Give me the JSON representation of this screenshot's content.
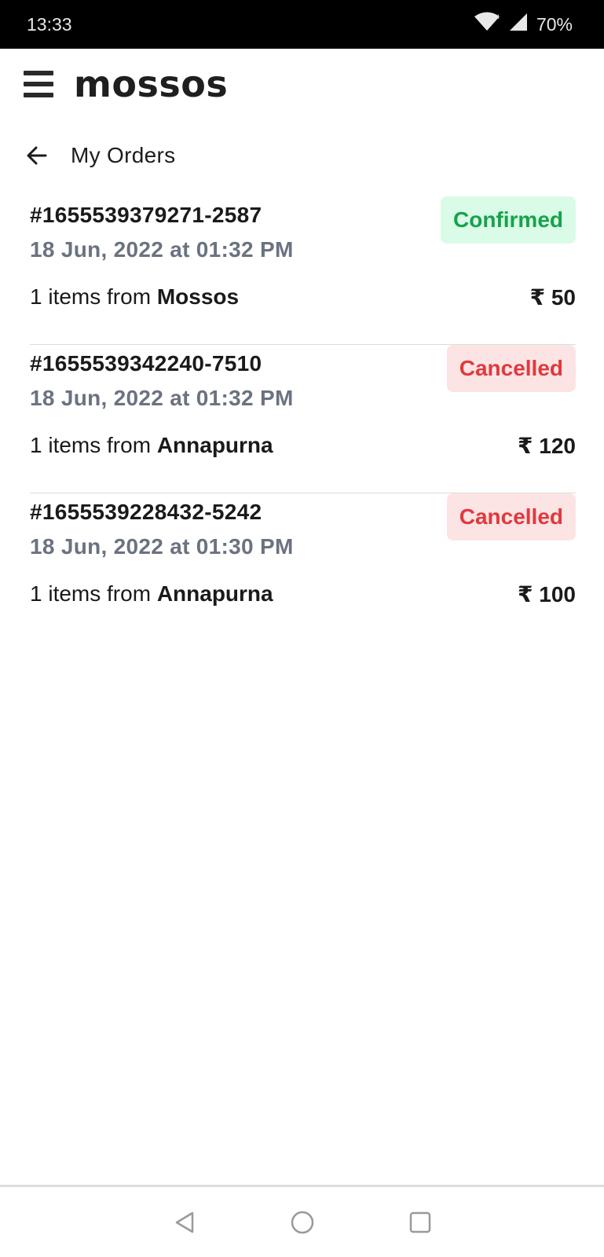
{
  "status_bar": {
    "time": "13:33",
    "battery": "70%",
    "icons": [
      "wifi-icon",
      "signal-icon"
    ]
  },
  "app": {
    "logo": "mossos"
  },
  "page": {
    "title": "My Orders"
  },
  "orders": [
    {
      "id": "#1655539379271-2587",
      "date": "18 Jun, 2022 at 01:32 PM",
      "items_prefix": "1 items from",
      "restaurant": "Mossos",
      "price": "₹ 50",
      "status": "Confirmed",
      "status_color": "#16a34a",
      "status_bg": "#d9fbe8"
    },
    {
      "id": "#1655539342240-7510",
      "date": "18 Jun, 2022 at 01:32 PM",
      "items_prefix": "1 items from",
      "restaurant": "Annapurna",
      "price": "₹ 120",
      "status": "Cancelled",
      "status_color": "#e0393e",
      "status_bg": "#fde4e4"
    },
    {
      "id": "#1655539228432-5242",
      "date": "18 Jun, 2022 at 01:30 PM",
      "items_prefix": "1 items from",
      "restaurant": "Annapurna",
      "price": "₹ 100",
      "status": "Cancelled",
      "status_color": "#e0393e",
      "status_bg": "#fde4e4"
    }
  ],
  "nav_bar": {
    "icons": [
      "back-triangle-icon",
      "home-circle-icon",
      "recents-square-icon"
    ]
  }
}
